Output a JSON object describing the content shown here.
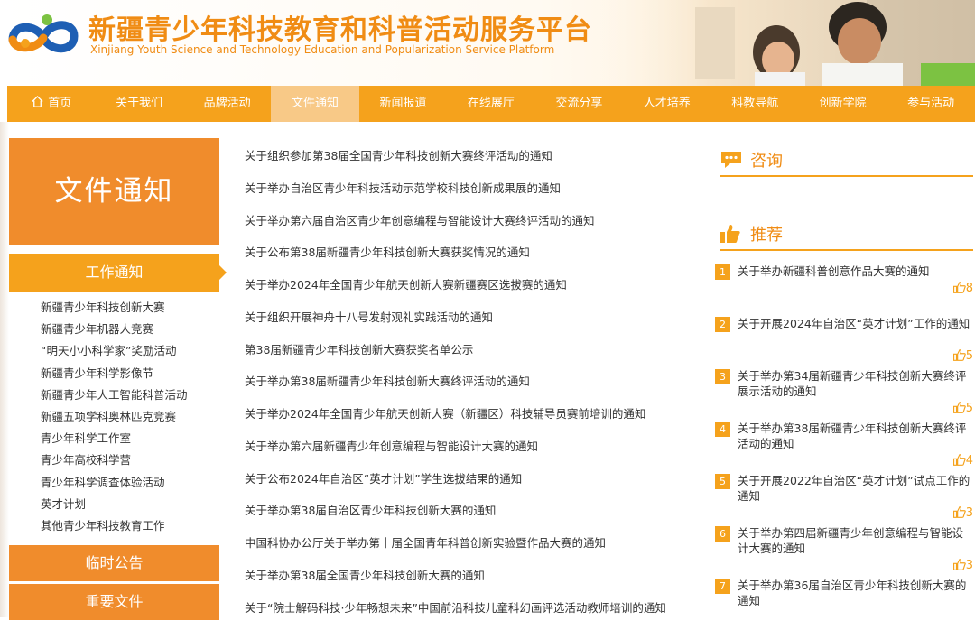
{
  "header": {
    "title": "新疆青少年科技教育和科普活动服务平台",
    "subtitle": "Xinjiang Youth Science and Technology Education and Popularization Service Platform"
  },
  "nav": {
    "items": [
      {
        "label": "首页"
      },
      {
        "label": "关于我们"
      },
      {
        "label": "品牌活动"
      },
      {
        "label": "文件通知",
        "active": true
      },
      {
        "label": "新闻报道"
      },
      {
        "label": "在线展厅"
      },
      {
        "label": "交流分享"
      },
      {
        "label": "人才培养"
      },
      {
        "label": "科教导航"
      },
      {
        "label": "创新学院"
      },
      {
        "label": "参与活动"
      }
    ]
  },
  "sidebar": {
    "title": "文件通知",
    "work_heading": "工作通知",
    "work_items": [
      "新疆青少年科技创新大赛",
      "新疆青少年机器人竞赛",
      "“明天小小科学家”奖励活动",
      "新疆青少年科学影像节",
      "新疆青少年人工智能科普活动",
      "新疆五项学科奥林匹克竞赛",
      "青少年科学工作室",
      "青少年高校科学营",
      "青少年科学调查体验活动",
      "英才计划",
      "其他青少年科技教育工作"
    ],
    "temp_notice": "临时公告",
    "important_docs": "重要文件"
  },
  "notices": [
    "关于组织参加第38届全国青少年科技创新大赛终评活动的通知",
    "关于举办自治区青少年科技活动示范学校科技创新成果展的通知",
    "关于举办第六届自治区青少年创意编程与智能设计大赛终评活动的通知",
    "关于公布第38届新疆青少年科技创新大赛获奖情况的通知",
    "关于举办2024年全国青少年航天创新大赛新疆赛区选拔赛的通知",
    "关于组织开展神舟十八号发射观礼实践活动的通知",
    "第38届新疆青少年科技创新大赛获奖名单公示",
    "关于举办第38届新疆青少年科技创新大赛终评活动的通知",
    "关于举办2024年全国青少年航天创新大赛（新疆区）科技辅导员赛前培训的通知",
    "关于举办第六届新疆青少年创意编程与智能设计大赛的通知",
    "关于公布2024年自治区“英才计划”学生选拔结果的通知",
    "关于举办第38届自治区青少年科技创新大赛的通知",
    "中国科协办公厅关于举办第十届全国青年科普创新实验暨作品大赛的通知",
    "关于举办第38届全国青少年科技创新大赛的通知",
    "关于“院士解码科技·少年畅想未来”中国前沿科技儿童科幻画评选活动教师培训的通知"
  ],
  "consult": {
    "label": "咨询"
  },
  "recommend": {
    "label": "推荐",
    "items": [
      {
        "num": "1",
        "text": "关于举办新疆科普创意作品大赛的通知",
        "likes": "8"
      },
      {
        "num": "2",
        "text": "关于开展2024年自治区“英才计划”工作的通知",
        "likes": "5"
      },
      {
        "num": "3",
        "text": "关于举办第34届新疆青少年科技创新大赛终评展示活动的通知",
        "likes": "5"
      },
      {
        "num": "4",
        "text": "关于举办第38届新疆青少年科技创新大赛终评活动的通知",
        "likes": "4"
      },
      {
        "num": "5",
        "text": "关于开展2022年自治区“英才计划”试点工作的通知",
        "likes": "3"
      },
      {
        "num": "6",
        "text": "关于举办第四届新疆青少年创意编程与智能设计大赛的通知",
        "likes": "3"
      },
      {
        "num": "7",
        "text": "关于举办第36届自治区青少年科技创新大赛的通知",
        "likes": ""
      }
    ]
  },
  "colors": {
    "brand_orange": "#f08c14",
    "nav_bg": "#f5a21c",
    "nav_active": "#f8c987",
    "logo_blue": "#1e5fb4",
    "logo_green": "#7cc242"
  },
  "icons": [
    "home-icon",
    "chat-icon",
    "thumbs-up-icon"
  ]
}
